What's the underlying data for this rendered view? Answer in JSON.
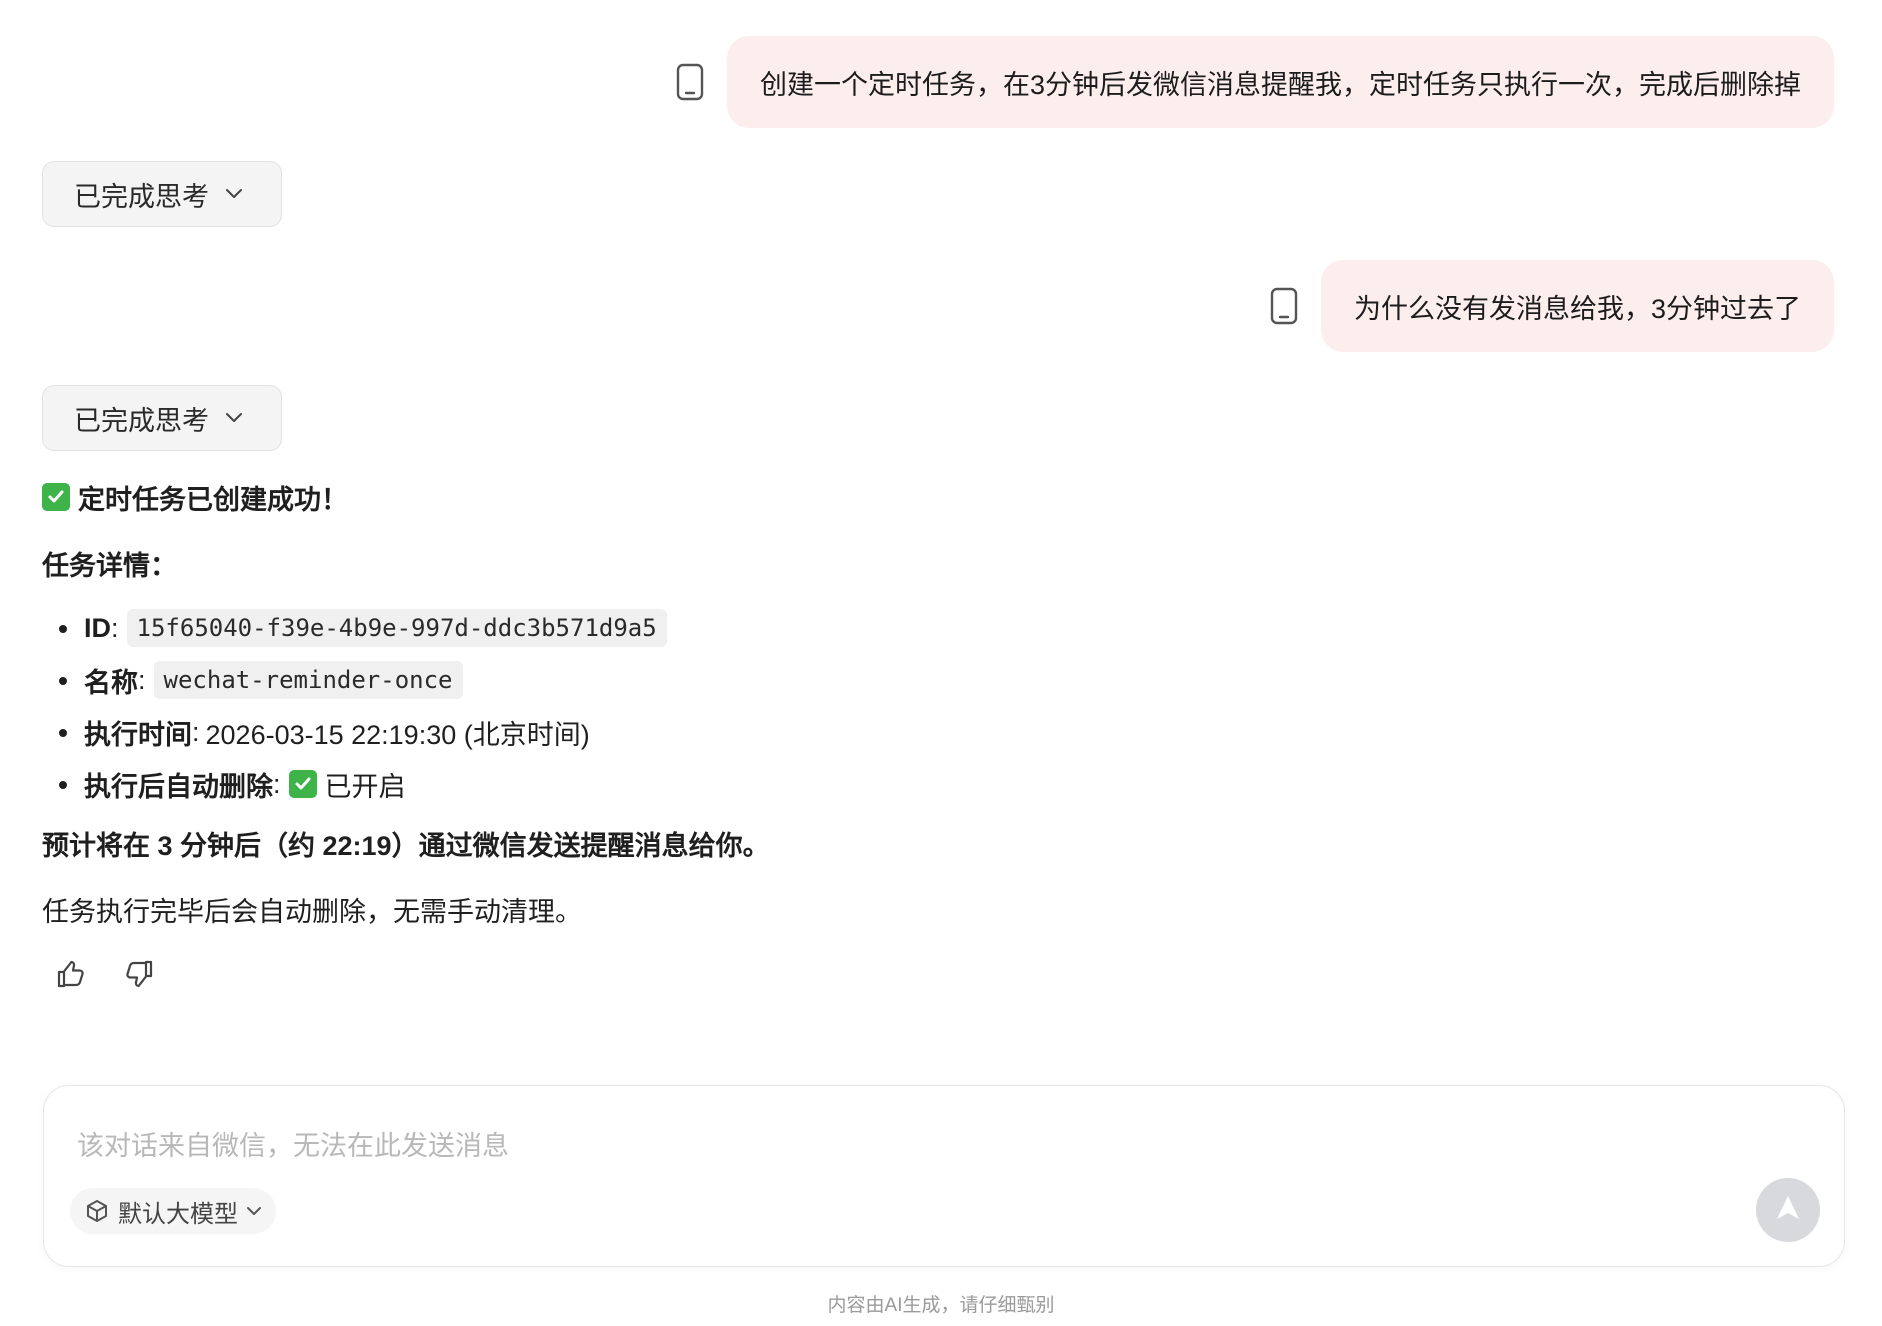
{
  "messages": {
    "user1": "创建一个定时任务，在3分钟后发微信消息提醒我，定时任务只执行一次，完成后删除掉",
    "user2": "为什么没有发消息给我，3分钟过去了",
    "thinking_label": "已完成思考"
  },
  "answer": {
    "title": "定时任务已创建成功！",
    "details_heading": "任务详情：",
    "details": [
      {
        "key": "ID",
        "sep": ":",
        "value": "15f65040-f39e-4b9e-997d-ddc3b571d9a5"
      },
      {
        "key": "名称",
        "sep": ":",
        "value": "wechat-reminder-once"
      },
      {
        "key": "执行时间",
        "sep": ":",
        "value": "2026-03-15 22:19:30 (北京时间)"
      },
      {
        "key": "执行后自动删除",
        "sep": ":",
        "value": "已开启"
      }
    ],
    "eta": "预计将在 3 分钟后（约 22:19）通过微信发送提醒消息给你。",
    "note": "任务执行完毕后会自动删除，无需手动清理。"
  },
  "composer": {
    "placeholder": "该对话来自微信，无法在此发送消息",
    "model_label": "默认大模型"
  },
  "footer": {
    "disclaimer": "内容由AI生成，请仔细甄别"
  },
  "colors": {
    "user_bubble": "#fdeeee",
    "check_green": "#3db34a",
    "send_disabled": "#d7d9dd"
  }
}
